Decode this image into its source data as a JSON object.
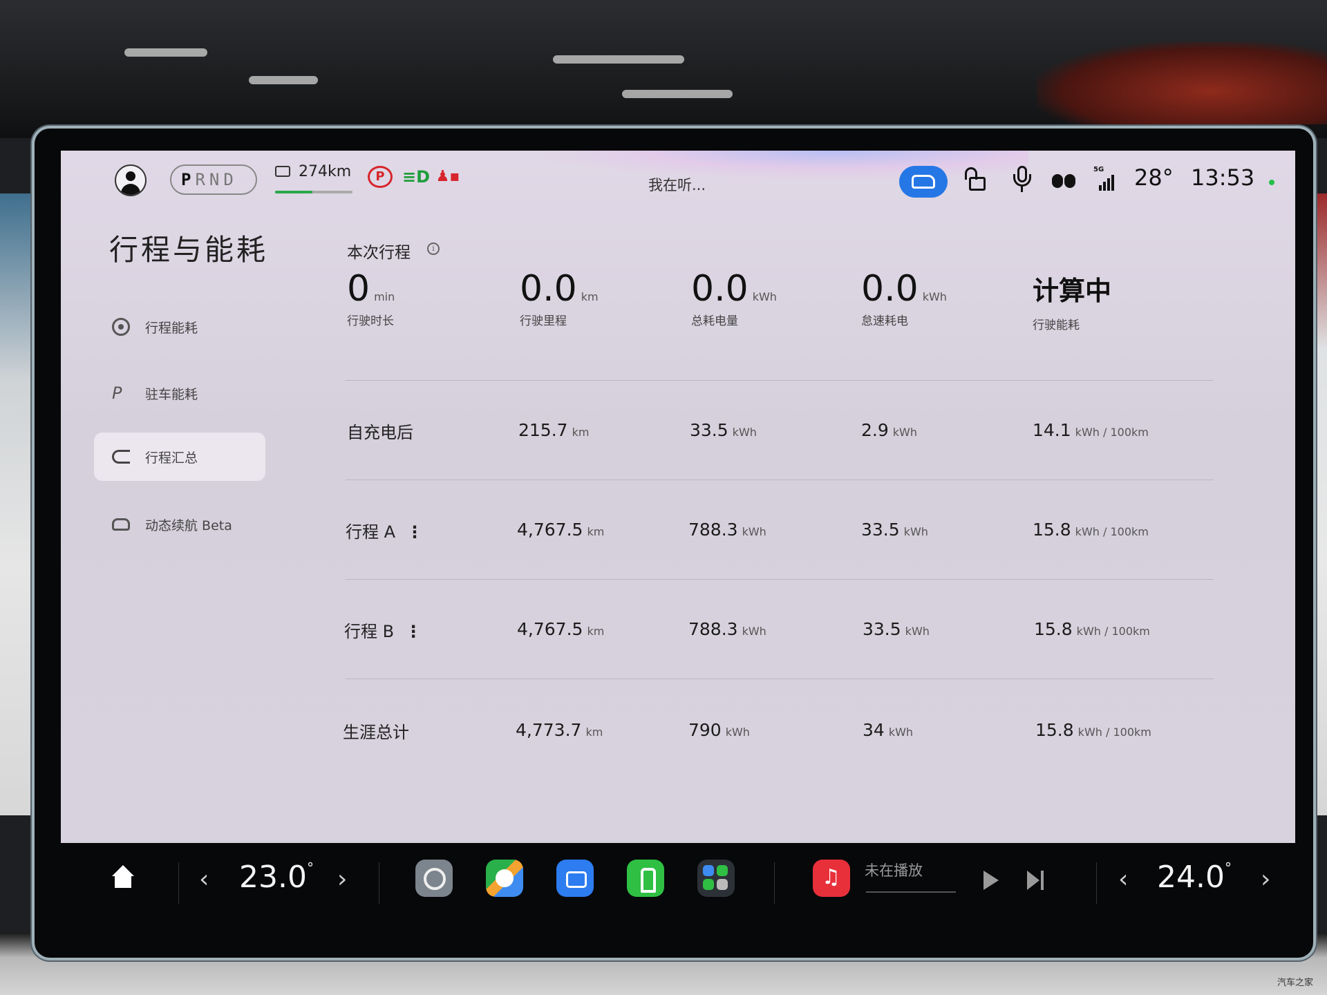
{
  "status_bar": {
    "gear": [
      "P",
      "R",
      "N",
      "D"
    ],
    "active_gear": "P",
    "range": "274km",
    "range_level_percent": 48,
    "voice_prompt": "我在听...",
    "temperature": "28°",
    "clock": "13:53",
    "signal_label": "5G",
    "colors": {
      "brake": "#d6252b",
      "light": "#1e9e3a",
      "accent": "#2677e6",
      "indicator": "#23c04a"
    }
  },
  "sidebar": {
    "title": "行程与能耗",
    "items": [
      {
        "label": "行程能耗",
        "icon": "steering-wheel-icon"
      },
      {
        "label": "驻车能耗",
        "icon": "parking-icon"
      },
      {
        "label": "行程汇总",
        "icon": "route-icon",
        "active": true
      },
      {
        "label": "动态续航 Beta",
        "icon": "car-icon"
      }
    ]
  },
  "current_trip": {
    "title": "本次行程",
    "stats": [
      {
        "value": "0",
        "unit": "min",
        "label": "行驶时长"
      },
      {
        "value": "0.0",
        "unit": "km",
        "label": "行驶里程"
      },
      {
        "value": "0.0",
        "unit": "kWh",
        "label": "总耗电量"
      },
      {
        "value": "0.0",
        "unit": "kWh",
        "label": "怠速耗电"
      },
      {
        "value": "计算中",
        "unit": "",
        "label": "行驶能耗"
      }
    ]
  },
  "rows": [
    {
      "label": "自充电后",
      "more": "",
      "distance": "215.7",
      "energy": "33.5",
      "idle": "2.9",
      "efficiency": "14.1"
    },
    {
      "label": "行程 A",
      "more": "⋮",
      "distance": "4,767.5",
      "energy": "788.3",
      "idle": "33.5",
      "efficiency": "15.8"
    },
    {
      "label": "行程 B",
      "more": "⋮",
      "distance": "4,767.5",
      "energy": "788.3",
      "idle": "33.5",
      "efficiency": "15.8"
    },
    {
      "label": "生涯总计",
      "more": "",
      "distance": "4,773.7",
      "energy": "790",
      "idle": "34",
      "efficiency": "15.8"
    }
  ],
  "units": {
    "distance": "km",
    "energy": "kWh",
    "idle": "kWh",
    "efficiency": "kWh / 100km"
  },
  "dock": {
    "left_temp": "23.0",
    "right_temp": "24.0",
    "degree": "°",
    "media_status": "未在播放",
    "apps": [
      "settings-app-icon",
      "navigation-app-icon",
      "video-app-icon",
      "seat-app-icon",
      "controls-app-icon",
      "music-app-icon"
    ]
  },
  "watermark": "汽车之家"
}
